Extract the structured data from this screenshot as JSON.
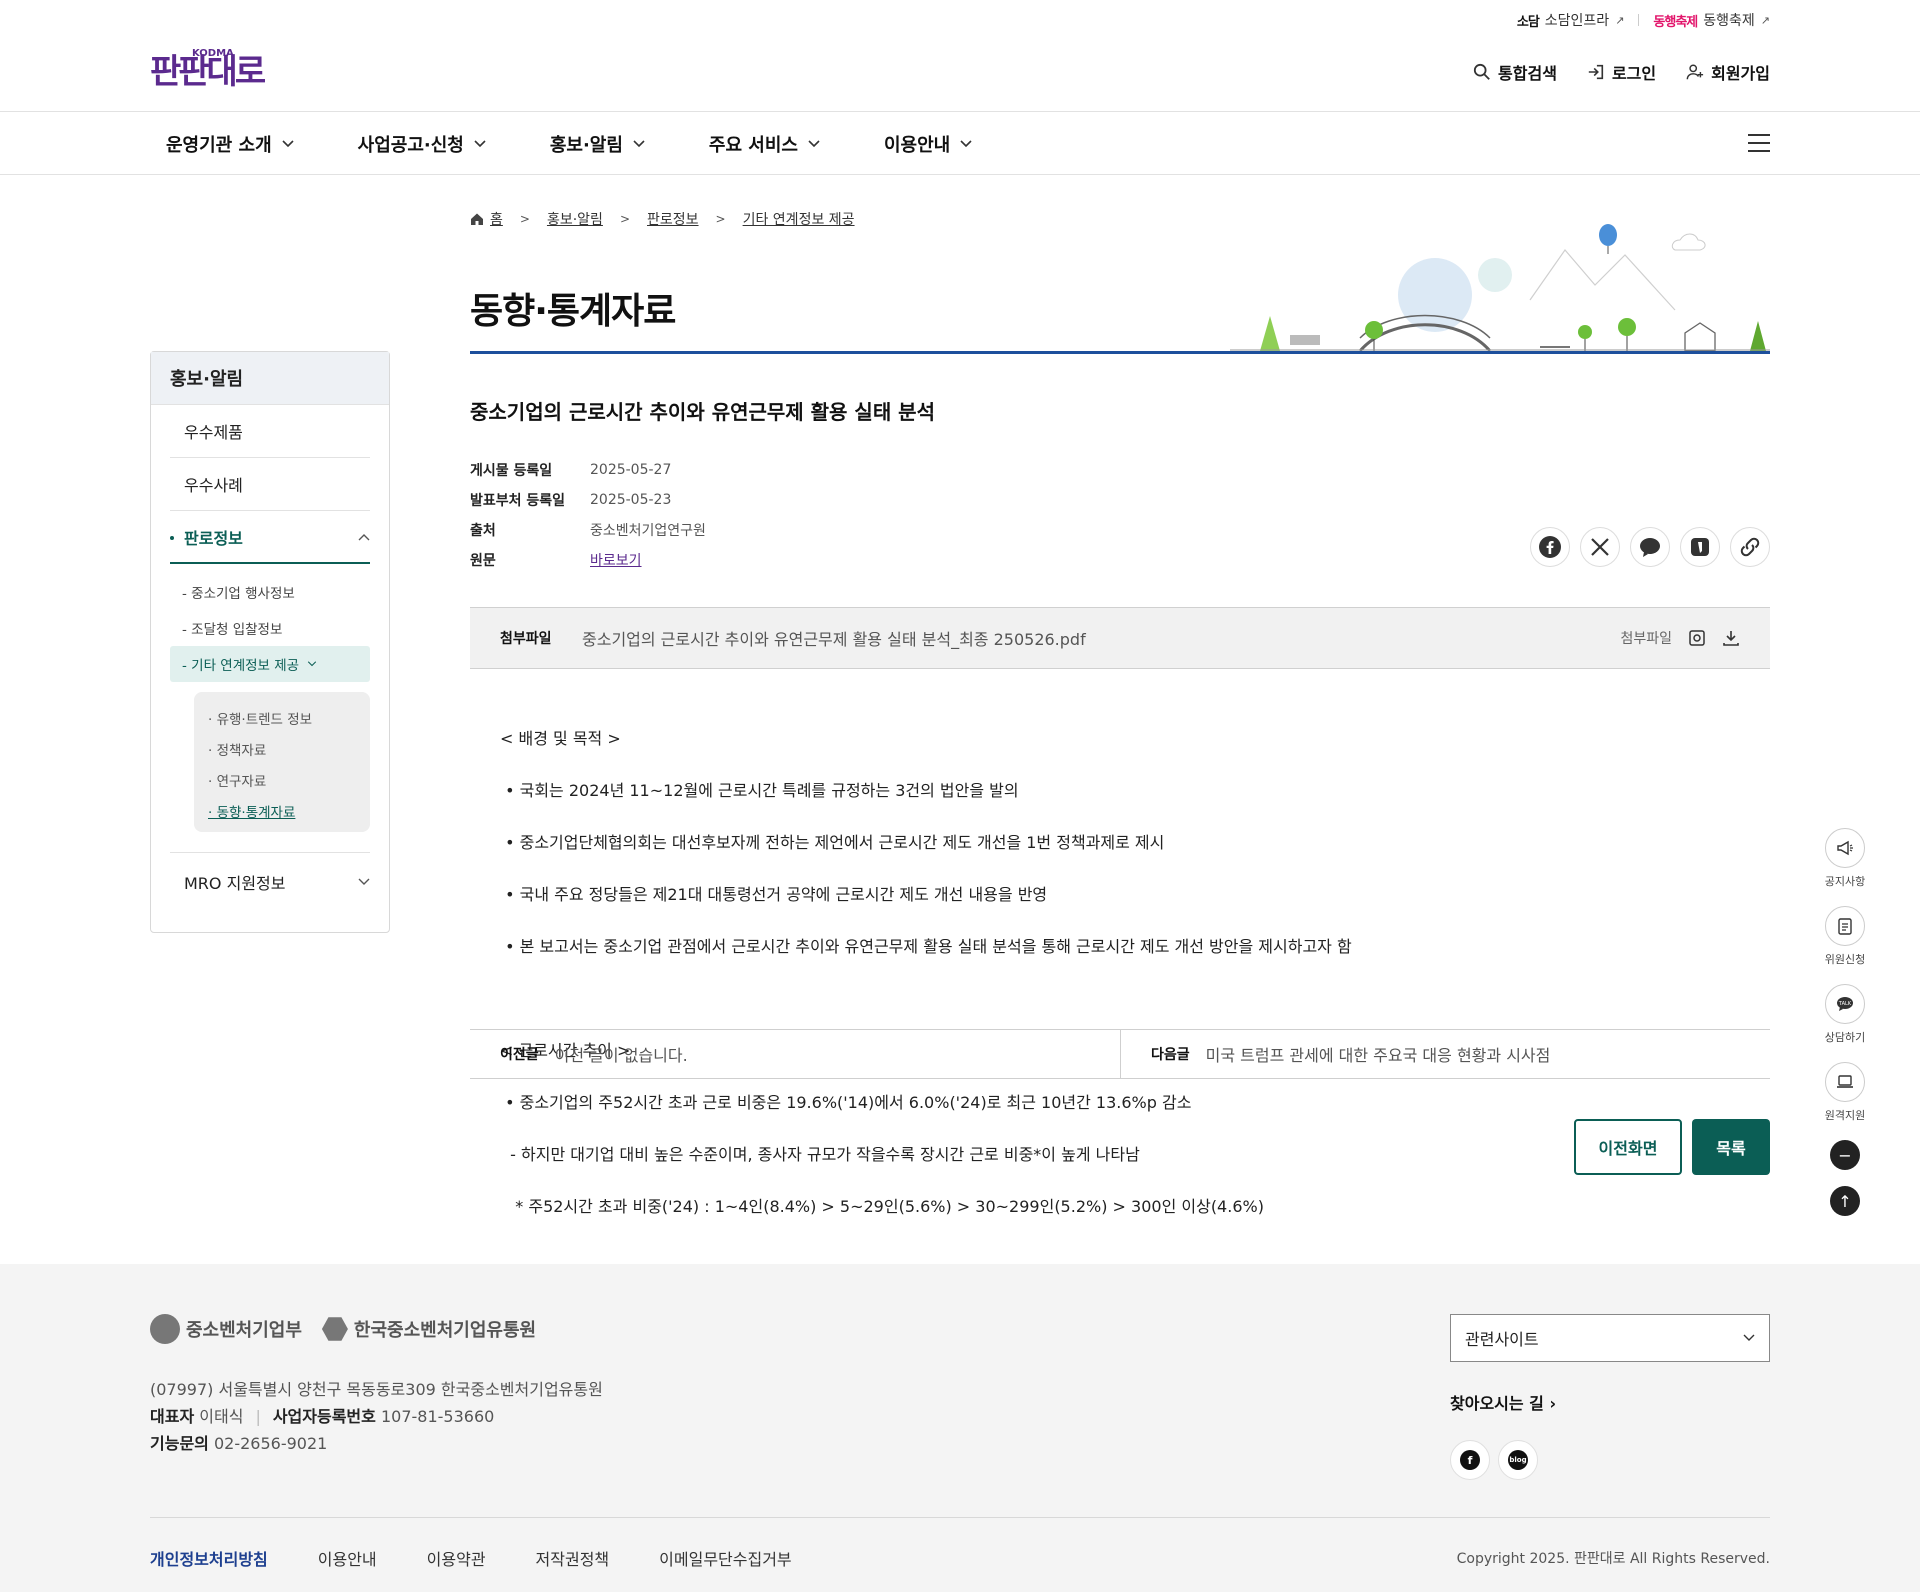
{
  "utility": {
    "sodam_logo": "소담",
    "sodam_label": "소담인프라",
    "festival_logo": "동행축제",
    "festival_label": "동행축제"
  },
  "brand": {
    "logo_text": "판판대로",
    "logo_sub": "KODMA"
  },
  "member": {
    "search": "통합검색",
    "login": "로그인",
    "join": "회원가입"
  },
  "gnb": [
    "운영기관 소개",
    "사업공고·신청",
    "홍보·알림",
    "주요 서비스",
    "이용안내"
  ],
  "lnb": {
    "title": "홍보·알림",
    "items": [
      "우수제품",
      "우수사례",
      "판로정보"
    ],
    "sub_items": [
      "- 중소기업 행사정보",
      "- 조달청 입찰정보",
      "- 기타 연계정보 제공"
    ],
    "third_items": [
      "· 유행·트렌드 정보",
      "· 정책자료",
      "· 연구자료",
      "· 동향·통계자료"
    ],
    "last_item": "MRO 지원정보"
  },
  "breadcrumb": [
    "홈",
    "홍보·알림",
    "판로정보",
    "기타 연계정보 제공"
  ],
  "page_title": "동향·통계자료",
  "article": {
    "title": "중소기업의 근로시간 추이와 유연근무제 활용 실태 분석",
    "meta": [
      {
        "k": "게시물 등록일",
        "v": "2025-05-27"
      },
      {
        "k": "발표부처 등록일",
        "v": "2025-05-23"
      },
      {
        "k": "출처",
        "v": "중소벤처기업연구원"
      },
      {
        "k": "원문",
        "v": "바로보기"
      }
    ],
    "attach_label": "첨부파일",
    "attach_file": "중소기업의 근로시간 추이와 유연근무제 활용 실태 분석_최종 250526.pdf",
    "attach_right": "첨부파일",
    "body": [
      "< 배경 및 목적 >",
      " • 국회는 2024년 11~12월에 근로시간 특례를 규정하는 3건의 법안을 발의",
      " • 중소기업단체협의회는 대선후보자께 전하는 제언에서 근로시간 제도 개선을 1번 정책과제로 제시",
      " • 국내 주요 정당들은 제21대 대통령선거 공약에 근로시간 제도 개선 내용을 반영",
      " • 본 보고서는 중소기업 관점에서 근로시간 추이와 유연근무제 활용 실태 분석을 통해 근로시간 제도 개선 방안을 제시하고자 함",
      "",
      "< 근로시간 추이 >",
      " • 중소기업의 주52시간 초과 근로 비중은 19.6%('14)에서 6.0%('24)로 최근 10년간 13.6%p 감소",
      "  - 하지만 대기업 대비 높은 수준이며, 종사자 규모가 작을수록 장시간 근로 비중*이 높게 나타남",
      "   * 주52시간 초과 비중('24) : 1~4인(8.4%) > 5~29인(5.6%) > 30~299인(5.2%) > 300인 이상(4.6%)"
    ]
  },
  "prev": {
    "label": "이전글",
    "text": "이전 글이 없습니다."
  },
  "next": {
    "label": "다음글",
    "text": "미국 트럼프 관세에 대한 주요국 대응 현황과 시사점"
  },
  "buttons": {
    "back": "이전화면",
    "list": "목록"
  },
  "quick": [
    "공지사항",
    "위원신청",
    "상담하기",
    "원격지원"
  ],
  "footer": {
    "logo1": "중소벤처기업부",
    "logo2": "한국중소벤처기업유통원",
    "address": "(07997) 서울특별시 양천구 목동동로309 한국중소벤처기업유통원",
    "ceo_label": "대표자",
    "ceo": "이태식",
    "biz_label": "사업자등록번호",
    "biz": "107-81-53660",
    "tel_label": "기능문의",
    "tel": "02-2656-9021",
    "related_site": "관련사이트",
    "directions": "찾아오시는 길",
    "sns_blog": "blog",
    "links": [
      "개인정보처리방침",
      "이용안내",
      "이용약관",
      "저작권정책",
      "이메일무단수집거부"
    ],
    "copyright": "Copyright 2025. 판판대로 All Rights Reserved."
  },
  "colors": {
    "accent": "#0b5e55",
    "title_line": "#1d4f9c",
    "brand": "#5b2a8e"
  }
}
